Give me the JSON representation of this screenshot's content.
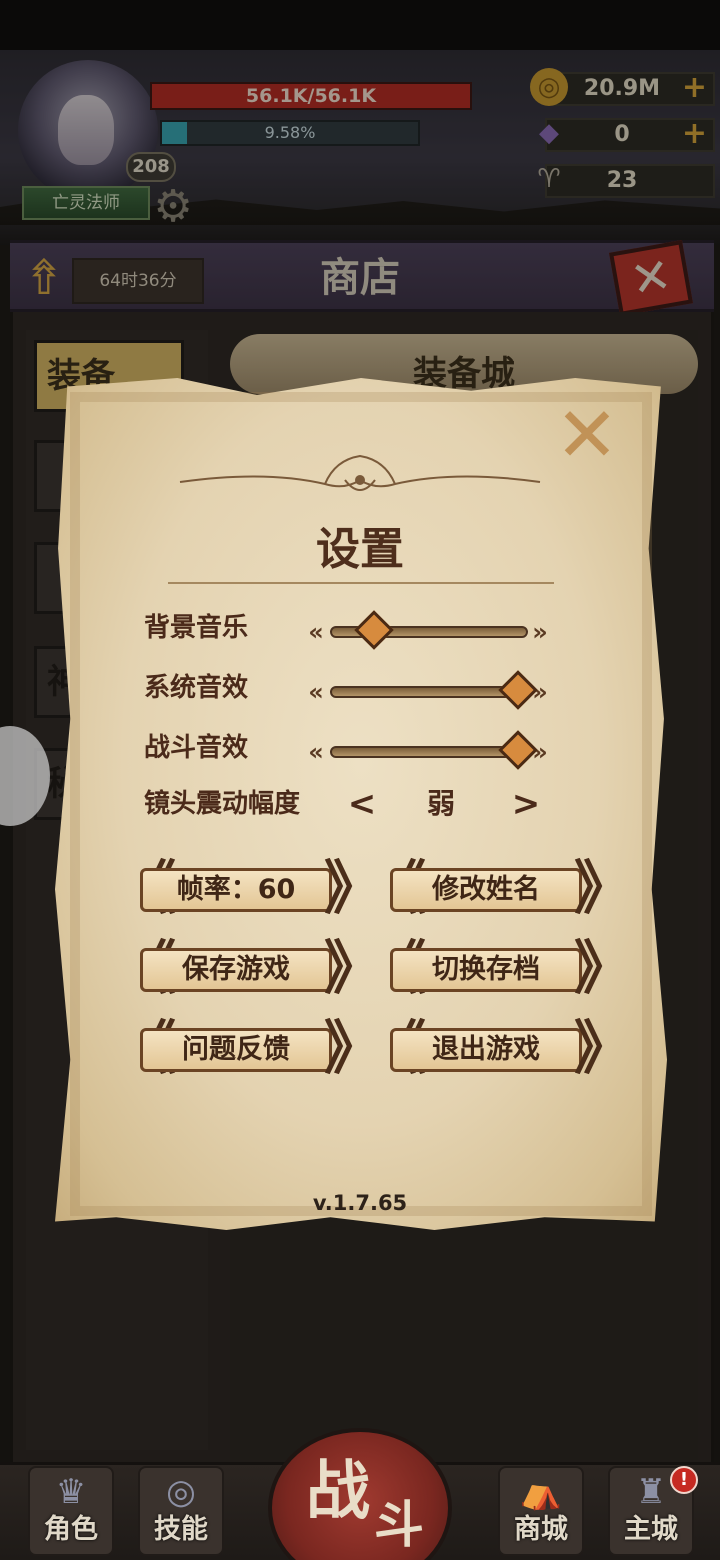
{
  "hud": {
    "hp_text": "56.1K/56.1K",
    "xp_text": "9.58%",
    "xp_fraction": 0.0958,
    "level": "208",
    "class_name": "亡灵法师",
    "resources": [
      {
        "icon": "gold-coin-icon",
        "value": "20.9M",
        "has_plus": true
      },
      {
        "icon": "purple-gem-icon",
        "value": "0",
        "has_plus": true
      },
      {
        "icon": "ram-horn-icon",
        "value": "23",
        "has_plus": false
      }
    ]
  },
  "shop": {
    "title": "商店",
    "timer": "64时36分",
    "tabs": [
      "装备",
      "",
      "",
      "神",
      "秘"
    ],
    "scroll_title": "装备城"
  },
  "settings": {
    "title": "设置",
    "sliders": [
      {
        "label": "背景音乐",
        "level": 0.22
      },
      {
        "label": "系统音效",
        "level": 0.95
      },
      {
        "label": "战斗音效",
        "level": 0.95
      }
    ],
    "shake": {
      "label": "镜头震动幅度",
      "value": "弱",
      "prev": "<",
      "next": ">"
    },
    "buttons": [
      "帧率：60",
      "修改姓名",
      "保存游戏",
      "切换存档",
      "问题反馈",
      "退出游戏"
    ],
    "version": "v.1.7.65"
  },
  "nav": {
    "role": "角色",
    "skills": "技能",
    "battle_1": "战",
    "battle_2": "斗",
    "mall": "商城",
    "main_city": "主城",
    "notif": "!"
  },
  "colors": {
    "parchment": "#e4d3b1",
    "ink": "#4b2a1a",
    "hp": "#b52a22",
    "xp": "#36a7b4",
    "accent_gold": "#d9a63a"
  }
}
